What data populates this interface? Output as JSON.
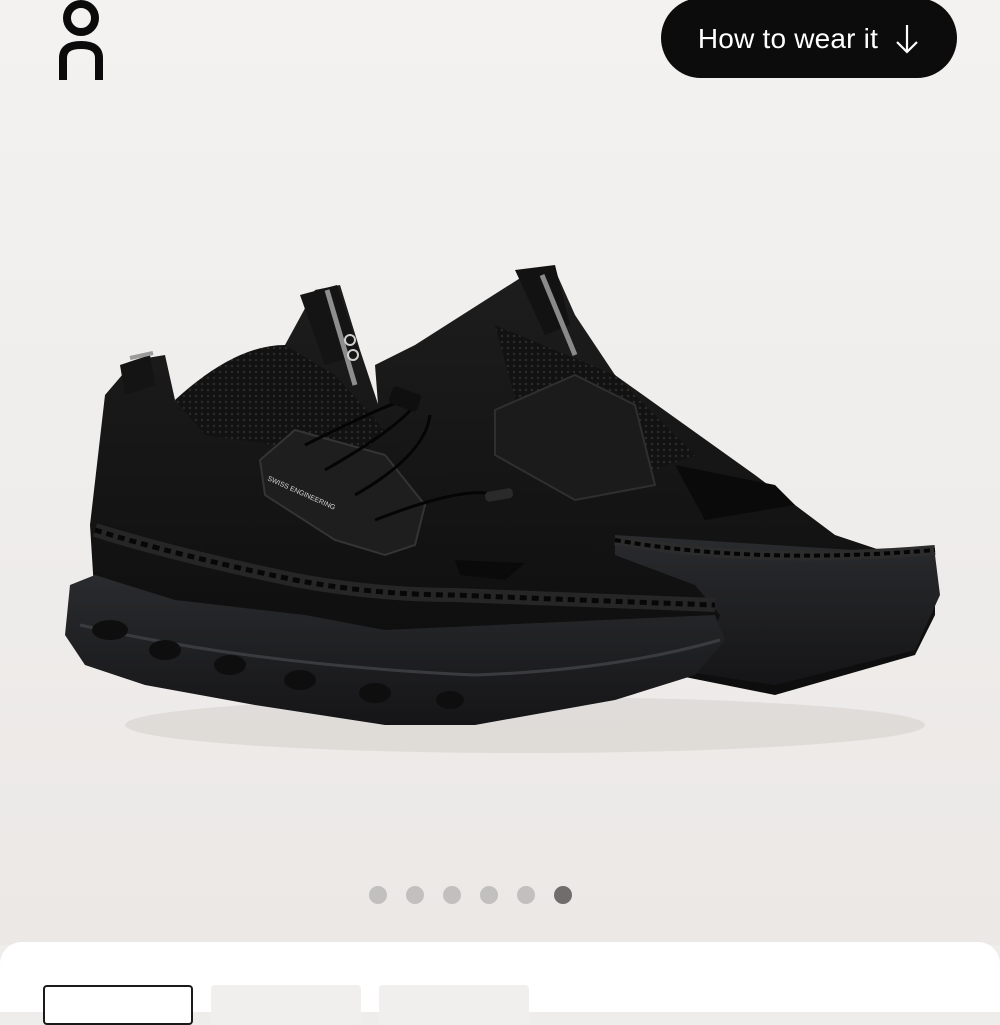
{
  "brand": {
    "logo_icon": "on-brand-logo-icon"
  },
  "header": {
    "wear_button_label": "How to wear it",
    "wear_button_icon": "arrow-down-icon"
  },
  "gallery": {
    "image_icon": "black-sneakers-product-photo",
    "slide_count": 6,
    "active_slide": 6,
    "dot_colors": {
      "inactive": "#c2c0bf",
      "active": "#6f6e6d"
    }
  },
  "colors": {
    "button_bg": "#0c0c0c",
    "button_text": "#ffffff",
    "page_bg": "#efedec"
  }
}
